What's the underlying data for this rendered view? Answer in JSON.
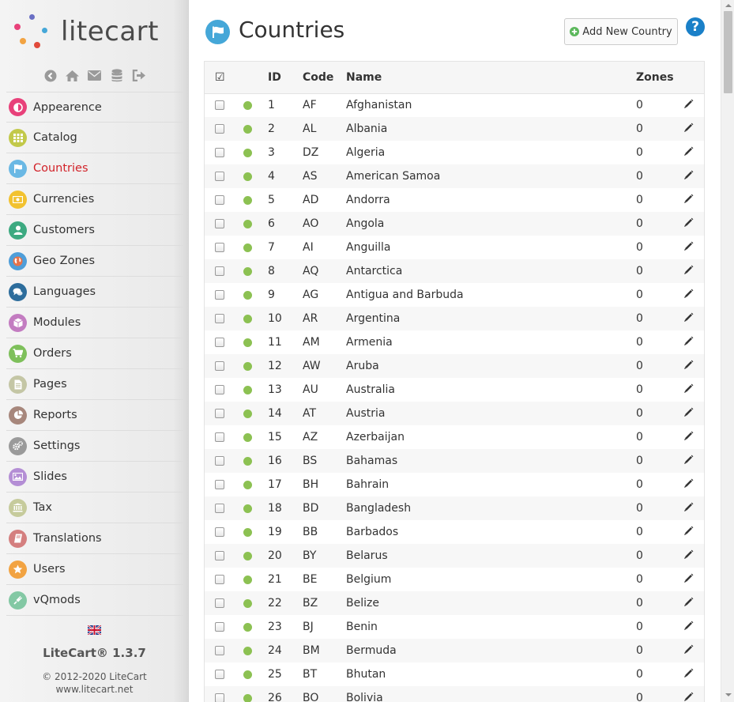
{
  "app": {
    "logo_text": "litecart",
    "version": "LiteCart® 1.3.7",
    "copyright": "© 2012-2020 LiteCart",
    "website": "www.litecart.net"
  },
  "shortcuts": [
    {
      "name": "back-icon"
    },
    {
      "name": "home-icon"
    },
    {
      "name": "envelope-icon"
    },
    {
      "name": "database-icon"
    },
    {
      "name": "sign-out-icon"
    }
  ],
  "menu": [
    {
      "key": "appearence",
      "label": "Appearence",
      "color": "#e8417a",
      "icon": "adjust-icon",
      "active": false
    },
    {
      "key": "catalog",
      "label": "Catalog",
      "color": "#c2c94a",
      "icon": "grid-icon",
      "active": false
    },
    {
      "key": "countries",
      "label": "Countries",
      "color": "#6ab8e4",
      "icon": "flag-icon",
      "active": true
    },
    {
      "key": "currencies",
      "label": "Currencies",
      "color": "#f2c230",
      "icon": "money-icon",
      "active": false
    },
    {
      "key": "customers",
      "label": "Customers",
      "color": "#3daa81",
      "icon": "user-icon",
      "active": false
    },
    {
      "key": "geo-zones",
      "label": "Geo Zones",
      "color": "#4f9ed9",
      "icon": "globe-icon",
      "active": false
    },
    {
      "key": "languages",
      "label": "Languages",
      "color": "#2d6d9c",
      "icon": "comments-icon",
      "active": false
    },
    {
      "key": "modules",
      "label": "Modules",
      "color": "#c37cc1",
      "icon": "cube-icon",
      "active": false
    },
    {
      "key": "orders",
      "label": "Orders",
      "color": "#7ec05b",
      "icon": "cart-icon",
      "active": false
    },
    {
      "key": "pages",
      "label": "Pages",
      "color": "#c4c6a5",
      "icon": "file-icon",
      "active": false
    },
    {
      "key": "reports",
      "label": "Reports",
      "color": "#a7877c",
      "icon": "pie-chart-icon",
      "active": false
    },
    {
      "key": "settings",
      "label": "Settings",
      "color": "#9a9a9a",
      "icon": "cogs-icon",
      "active": false
    },
    {
      "key": "slides",
      "label": "Slides",
      "color": "#b48ed5",
      "icon": "picture-icon",
      "active": false
    },
    {
      "key": "tax",
      "label": "Tax",
      "color": "#c6cb9c",
      "icon": "bank-icon",
      "active": false
    },
    {
      "key": "translations",
      "label": "Translations",
      "color": "#d47f7f",
      "icon": "book-icon",
      "active": false
    },
    {
      "key": "users",
      "label": "Users",
      "color": "#f2a342",
      "icon": "star-icon",
      "active": false
    },
    {
      "key": "vqmods",
      "label": "vQmods",
      "color": "#83c8a4",
      "icon": "plug-icon",
      "active": false
    }
  ],
  "page": {
    "title": "Countries",
    "add_button_label": "Add New Country",
    "help_label": "?"
  },
  "table": {
    "headers": {
      "select_all": "☑",
      "id": "ID",
      "code": "Code",
      "name": "Name",
      "zones": "Zones"
    },
    "status_color": "#8cc152",
    "rows": [
      {
        "id": "1",
        "code": "AF",
        "name": "Afghanistan",
        "zones": "0"
      },
      {
        "id": "2",
        "code": "AL",
        "name": "Albania",
        "zones": "0"
      },
      {
        "id": "3",
        "code": "DZ",
        "name": "Algeria",
        "zones": "0"
      },
      {
        "id": "4",
        "code": "AS",
        "name": "American Samoa",
        "zones": "0"
      },
      {
        "id": "5",
        "code": "AD",
        "name": "Andorra",
        "zones": "0"
      },
      {
        "id": "6",
        "code": "AO",
        "name": "Angola",
        "zones": "0"
      },
      {
        "id": "7",
        "code": "AI",
        "name": "Anguilla",
        "zones": "0"
      },
      {
        "id": "8",
        "code": "AQ",
        "name": "Antarctica",
        "zones": "0"
      },
      {
        "id": "9",
        "code": "AG",
        "name": "Antigua and Barbuda",
        "zones": "0"
      },
      {
        "id": "10",
        "code": "AR",
        "name": "Argentina",
        "zones": "0"
      },
      {
        "id": "11",
        "code": "AM",
        "name": "Armenia",
        "zones": "0"
      },
      {
        "id": "12",
        "code": "AW",
        "name": "Aruba",
        "zones": "0"
      },
      {
        "id": "13",
        "code": "AU",
        "name": "Australia",
        "zones": "0"
      },
      {
        "id": "14",
        "code": "AT",
        "name": "Austria",
        "zones": "0"
      },
      {
        "id": "15",
        "code": "AZ",
        "name": "Azerbaijan",
        "zones": "0"
      },
      {
        "id": "16",
        "code": "BS",
        "name": "Bahamas",
        "zones": "0"
      },
      {
        "id": "17",
        "code": "BH",
        "name": "Bahrain",
        "zones": "0"
      },
      {
        "id": "18",
        "code": "BD",
        "name": "Bangladesh",
        "zones": "0"
      },
      {
        "id": "19",
        "code": "BB",
        "name": "Barbados",
        "zones": "0"
      },
      {
        "id": "20",
        "code": "BY",
        "name": "Belarus",
        "zones": "0"
      },
      {
        "id": "21",
        "code": "BE",
        "name": "Belgium",
        "zones": "0"
      },
      {
        "id": "22",
        "code": "BZ",
        "name": "Belize",
        "zones": "0"
      },
      {
        "id": "23",
        "code": "BJ",
        "name": "Benin",
        "zones": "0"
      },
      {
        "id": "24",
        "code": "BM",
        "name": "Bermuda",
        "zones": "0"
      },
      {
        "id": "25",
        "code": "BT",
        "name": "Bhutan",
        "zones": "0"
      },
      {
        "id": "26",
        "code": "BO",
        "name": "Bolivia",
        "zones": "0"
      }
    ]
  }
}
